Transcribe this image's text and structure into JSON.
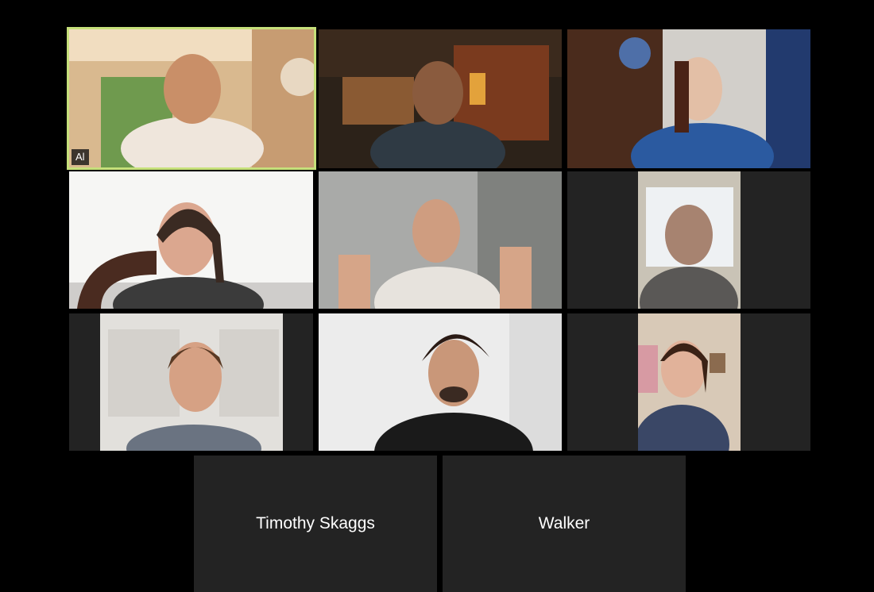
{
  "meeting": {
    "view": "gallery",
    "active_speaker_color": "#c6e07a"
  },
  "participants": [
    {
      "badge": "Al",
      "active": true,
      "video": true,
      "avatar_icon": "person-video-icon"
    },
    {
      "video": true,
      "avatar_icon": "person-video-icon"
    },
    {
      "video": true,
      "avatar_icon": "person-video-icon"
    },
    {
      "video": true,
      "avatar_icon": "person-video-icon"
    },
    {
      "video": true,
      "avatar_icon": "person-video-icon"
    },
    {
      "video": true,
      "avatar_icon": "person-video-icon"
    },
    {
      "video": true,
      "avatar_icon": "person-video-icon"
    },
    {
      "video": true,
      "avatar_icon": "person-video-icon"
    },
    {
      "video": true,
      "avatar_icon": "person-video-icon"
    },
    {
      "name": "Timothy Skaggs",
      "video": false
    },
    {
      "name": "Walker",
      "video": false
    }
  ]
}
